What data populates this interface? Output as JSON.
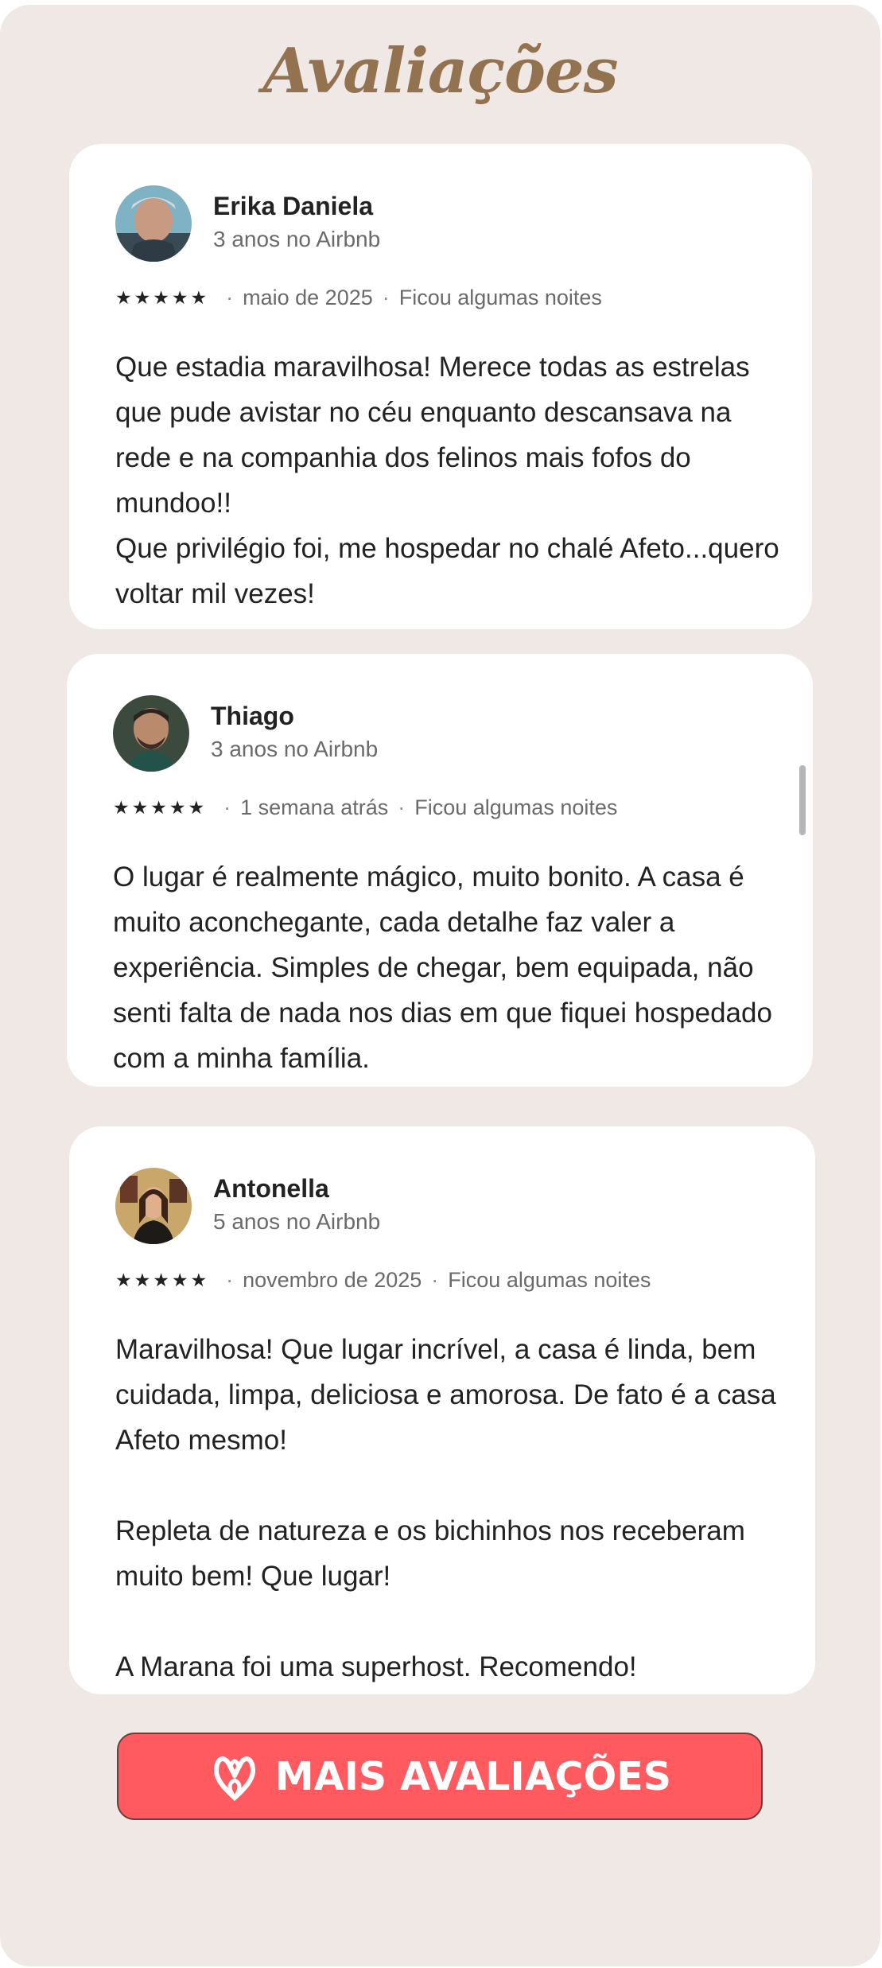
{
  "header": {
    "title": "Avaliações"
  },
  "reviews": [
    {
      "name": "Erika Daniela",
      "tenure": "3 anos no Airbnb",
      "rating": 5,
      "date": "maio de 2025",
      "stay": "Ficou algumas noites",
      "text": "Que estadia maravilhosa! Merece todas as estrelas que pude avistar no céu enquanto descansava na rede e na companhia dos felinos mais fofos do mundoo!!\nQue privilégio foi, me hospedar no chalé Afeto...quero voltar mil vezes!"
    },
    {
      "name": "Thiago",
      "tenure": "3 anos no Airbnb",
      "rating": 5,
      "date": "1 semana atrás",
      "stay": "Ficou algumas noites",
      "text": "O lugar é realmente mágico, muito bonito. A casa é muito aconchegante, cada detalhe faz valer a experiência. Simples de chegar, bem equipada, não senti falta de nada nos dias em que fiquei hospedado com a minha família."
    },
    {
      "name": "Antonella",
      "tenure": "5 anos no Airbnb",
      "rating": 5,
      "date": "novembro de 2025",
      "stay": "Ficou algumas noites",
      "text": "Maravilhosa! Que lugar incrível, a casa é linda, bem cuidada, limpa, deliciosa e amorosa. De fato é a casa Afeto mesmo!\n\nRepleta de natureza e os bichinhos nos receberam muito bem! Que lugar!\n\nA Marana foi uma superhost. Recomendo!"
    }
  ],
  "cta": {
    "label": "MAIS AVALIAÇÕES",
    "icon": "airbnb-logo-icon"
  },
  "colors": {
    "background": "#f0e8e5",
    "title": "#93724f",
    "card": "#ffffff",
    "text": "#222222",
    "muted": "#6a6a6a",
    "cta": "#ff5a5f"
  }
}
